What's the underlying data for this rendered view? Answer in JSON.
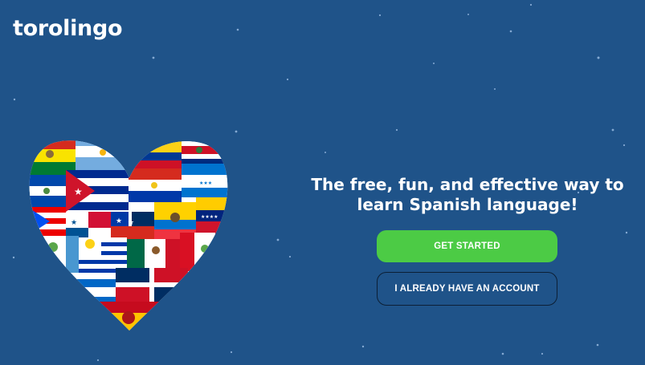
{
  "header": {
    "brand": "torolingo"
  },
  "hero": {
    "tagline": "The free, fun, and effective way to learn Spanish language!",
    "primary_button": "GET STARTED",
    "secondary_button": "I ALREADY HAVE AN ACCOUNT"
  },
  "colors": {
    "background": "#1f5389",
    "primary_button": "#4ccb45",
    "text": "#ffffff"
  },
  "illustration": {
    "icon": "heart-of-spanish-speaking-country-flags"
  }
}
